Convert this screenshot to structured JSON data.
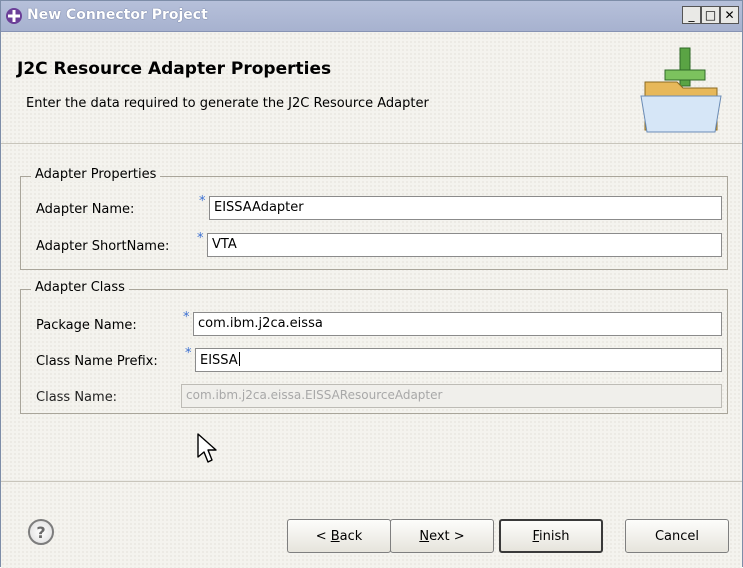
{
  "window": {
    "title": "New Connector Project",
    "controls": {
      "minimize": "_",
      "maximize": "□",
      "close": "✕"
    }
  },
  "header": {
    "title": "J2C Resource Adapter Properties",
    "description": "Enter the data required to generate the J2C Resource Adapter"
  },
  "adapter_properties": {
    "legend": "Adapter Properties",
    "name_label": "Adapter Name:",
    "name_value": "EISSAAdapter",
    "shortname_label": "Adapter ShortName:",
    "shortname_value": "VTA"
  },
  "adapter_class": {
    "legend": "Adapter Class",
    "package_label": "Package Name:",
    "package_value": "com.ibm.j2ca.eissa",
    "prefix_label": "Class Name Prefix:",
    "prefix_value": "EISSA",
    "classname_label": "Class Name:",
    "classname_value": "com.ibm.j2ca.eissa.EISSAResourceAdapter"
  },
  "required_marker": "*",
  "footer": {
    "help_glyph": "?",
    "back_pre": "< ",
    "back_mnemonic": "B",
    "back_rest": "ack",
    "next_mnemonic": "N",
    "next_rest": "ext >",
    "finish_mnemonic": "F",
    "finish_rest": "inish",
    "cancel": "Cancel"
  },
  "icons": [
    "app-icon",
    "wizard-folder-icon",
    "help-icon",
    "mouse-cursor-icon"
  ],
  "colors": {
    "title_bar": "#a7b2cf",
    "required_marker": "#3b6fd0"
  }
}
